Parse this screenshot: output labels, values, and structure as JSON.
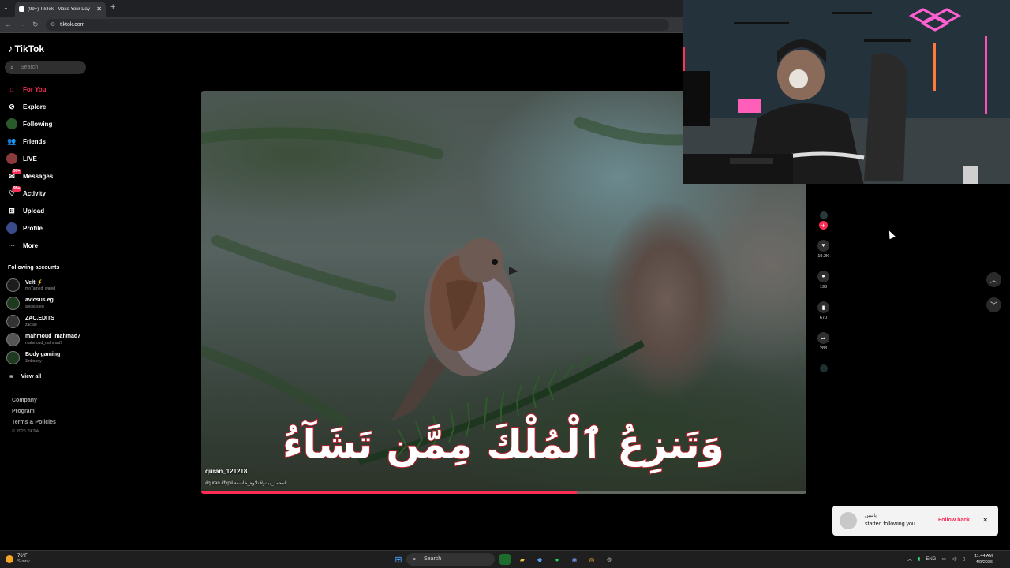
{
  "browser": {
    "tab_title": "(99+) TikTok - Make Your Day",
    "url": "tiktok.com"
  },
  "sidebar": {
    "logo": "TikTok",
    "search_placeholder": "Search",
    "nav": [
      {
        "label": "For You",
        "icon": "home-icon",
        "badge": ""
      },
      {
        "label": "Explore",
        "icon": "compass-icon",
        "badge": ""
      },
      {
        "label": "Following",
        "icon": "following-icon",
        "badge": ""
      },
      {
        "label": "Friends",
        "icon": "friends-icon",
        "badge": ""
      },
      {
        "label": "LIVE",
        "icon": "live-icon",
        "badge": ""
      },
      {
        "label": "Messages",
        "icon": "messages-icon",
        "badge": "99+"
      },
      {
        "label": "Activity",
        "icon": "activity-icon",
        "badge": "99+"
      },
      {
        "label": "Upload",
        "icon": "upload-icon",
        "badge": ""
      },
      {
        "label": "Profile",
        "icon": "profile-icon",
        "badge": ""
      },
      {
        "label": "More",
        "icon": "more-icon",
        "badge": ""
      }
    ],
    "following_title": "Following accounts",
    "accounts": [
      {
        "name": "Velt ⚡",
        "handle": "mo7amed_waled"
      },
      {
        "name": "avicsus.eg",
        "handle": "avicsus.eg"
      },
      {
        "name": "ZAC.EDITS",
        "handle": "zac.ae"
      },
      {
        "name": "mahmoud_mahmad7",
        "handle": "mahmoud_mahmad7"
      },
      {
        "name": "Body gaming",
        "handle": "3mboody"
      }
    ],
    "view_all": "View all",
    "footer": [
      "Company",
      "Program",
      "Terms & Policies"
    ],
    "copyright": "© 2026 TikTok"
  },
  "video": {
    "username": "quran_121218",
    "caption": "#quran #fyp# محمد_بيبتو# تلاوة_خاشعة#",
    "arabic_text": "وَتَنزِعُ ٱلْمُلْكَ مِمَّن تَشَآءُ",
    "progress": 0.62
  },
  "actions": {
    "likes": "19.2K",
    "comments": "193",
    "saves": "670",
    "shares": "288"
  },
  "notification": {
    "name": "ياسين",
    "message": "started following you.",
    "button": "Follow back"
  },
  "taskbar": {
    "temp": "76°F",
    "condition": "Sunny",
    "search": "Search",
    "lang": "ENG",
    "time": "11:44 AM",
    "date": "4/9/2026"
  },
  "colors": {
    "accent": "#fe2c55",
    "background": "#000000"
  }
}
